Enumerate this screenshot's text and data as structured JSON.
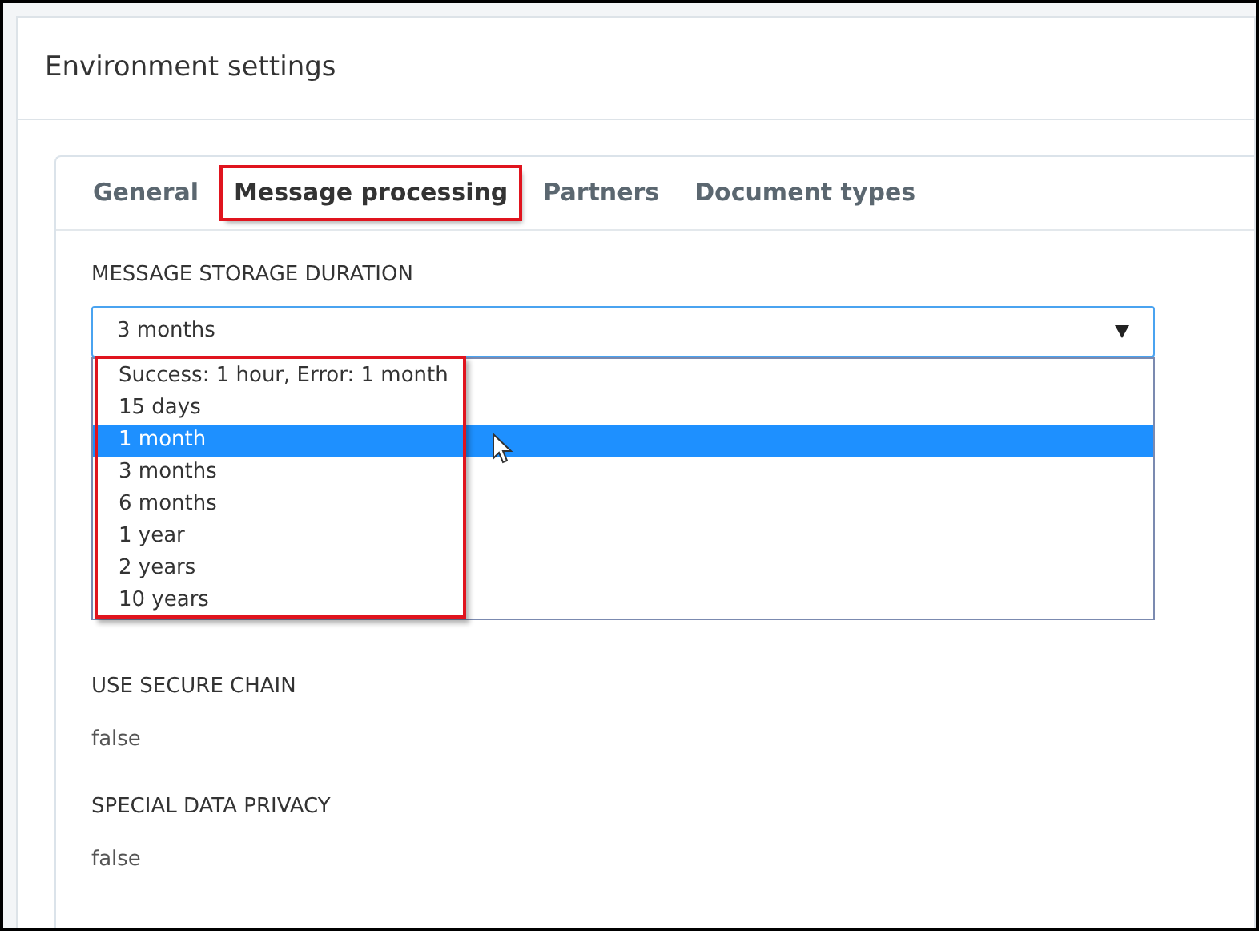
{
  "title": "Environment settings",
  "tabs": [
    {
      "label": "General",
      "selected": false,
      "highlighted": false
    },
    {
      "label": "Message processing",
      "selected": true,
      "highlighted": true
    },
    {
      "label": "Partners",
      "selected": false,
      "highlighted": false
    },
    {
      "label": "Document types",
      "selected": false,
      "highlighted": false
    }
  ],
  "storage": {
    "label": "MESSAGE STORAGE DURATION",
    "value": "3 months",
    "expanded": true,
    "options_highlighted": true,
    "options": [
      {
        "label": "Success: 1 hour, Error: 1 month",
        "hovered": false
      },
      {
        "label": "15 days",
        "hovered": false
      },
      {
        "label": "1 month",
        "hovered": true
      },
      {
        "label": "3 months",
        "hovered": false
      },
      {
        "label": "6 months",
        "hovered": false
      },
      {
        "label": "1 year",
        "hovered": false
      },
      {
        "label": "2 years",
        "hovered": false
      },
      {
        "label": "10 years",
        "hovered": false
      }
    ]
  },
  "fields": [
    {
      "label": "USE SECURE CHAIN",
      "value": "false"
    },
    {
      "label": "SPECIAL DATA PRIVACY",
      "value": "false"
    }
  ]
}
